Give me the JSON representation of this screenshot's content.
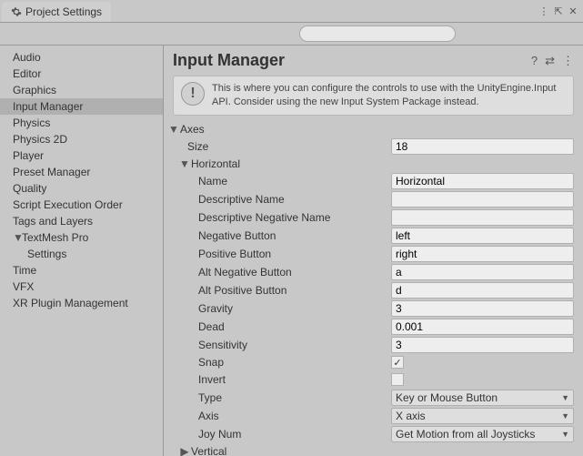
{
  "tab": {
    "title": "Project Settings"
  },
  "titlebar_icons": {
    "menu": "⋮",
    "undock": "⇱",
    "close": "✕"
  },
  "search": {
    "placeholder": ""
  },
  "sidebar": {
    "items": [
      {
        "label": "Audio"
      },
      {
        "label": "Editor"
      },
      {
        "label": "Graphics"
      },
      {
        "label": "Input Manager",
        "selected": true
      },
      {
        "label": "Physics"
      },
      {
        "label": "Physics 2D"
      },
      {
        "label": "Player"
      },
      {
        "label": "Preset Manager"
      },
      {
        "label": "Quality"
      },
      {
        "label": "Script Execution Order"
      },
      {
        "label": "Tags and Layers"
      },
      {
        "label": "TextMesh Pro",
        "fold": "▼"
      },
      {
        "label": "Settings",
        "child": true
      },
      {
        "label": "Time"
      },
      {
        "label": "VFX"
      },
      {
        "label": "XR Plugin Management"
      }
    ]
  },
  "main": {
    "title": "Input Manager",
    "header_icons": {
      "help": "?",
      "preset": "⇄",
      "menu": "⋮"
    },
    "info": "This is where you can configure the controls to use with the UnityEngine.Input API. Consider using the new Input System Package instead.",
    "axes_label": "Axes",
    "size_label": "Size",
    "size_value": "18",
    "axis_name": "Horizontal",
    "vertical_label": "Vertical",
    "props": {
      "name": {
        "label": "Name",
        "value": "Horizontal"
      },
      "desc": {
        "label": "Descriptive Name",
        "value": ""
      },
      "descneg": {
        "label": "Descriptive Negative Name",
        "value": ""
      },
      "negbtn": {
        "label": "Negative Button",
        "value": "left"
      },
      "posbtn": {
        "label": "Positive Button",
        "value": "right"
      },
      "altneg": {
        "label": "Alt Negative Button",
        "value": "a"
      },
      "altpos": {
        "label": "Alt Positive Button",
        "value": "d"
      },
      "gravity": {
        "label": "Gravity",
        "value": "3"
      },
      "dead": {
        "label": "Dead",
        "value": "0.001"
      },
      "sens": {
        "label": "Sensitivity",
        "value": "3"
      },
      "snap": {
        "label": "Snap",
        "checked": true
      },
      "invert": {
        "label": "Invert",
        "checked": false
      },
      "type": {
        "label": "Type",
        "value": "Key or Mouse Button"
      },
      "axis": {
        "label": "Axis",
        "value": "X axis"
      },
      "joy": {
        "label": "Joy Num",
        "value": "Get Motion from all Joysticks"
      }
    }
  }
}
